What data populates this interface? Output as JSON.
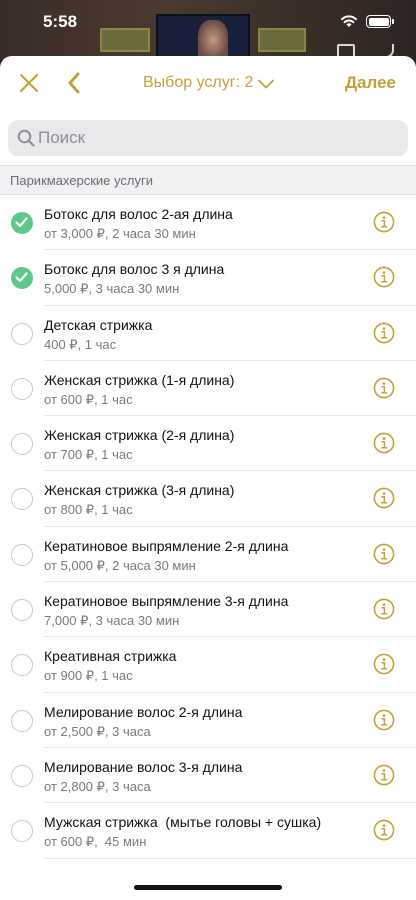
{
  "status_bar": {
    "time": "5:58"
  },
  "nav": {
    "title": "Выбор услуг: 2",
    "next_label": "Далее"
  },
  "search": {
    "placeholder": "Поиск"
  },
  "section": {
    "title": "Парикмахерские услуги"
  },
  "colors": {
    "accent": "#c4a03a",
    "check": "#5cc98b"
  },
  "services": [
    {
      "name": "Ботокс для волос 2-ая длина",
      "meta": "от 3,000 ₽, 2 часа 30 мин",
      "selected": true
    },
    {
      "name": "Ботокс для волос 3 я длина",
      "meta": "5,000 ₽, 3 часа 30 мин",
      "selected": true
    },
    {
      "name": "Детская стрижка",
      "meta": "400 ₽, 1 час",
      "selected": false
    },
    {
      "name": "Женская стрижка (1-я длина)",
      "meta": "от 600 ₽, 1 час",
      "selected": false
    },
    {
      "name": "Женская стрижка (2-я длина)",
      "meta": "от 700 ₽, 1 час",
      "selected": false
    },
    {
      "name": "Женская стрижка (3-я длина)",
      "meta": "от 800 ₽, 1 час",
      "selected": false
    },
    {
      "name": "Кератиновое выпрямление 2-я длина",
      "meta": "от 5,000 ₽, 2 часа 30 мин",
      "selected": false
    },
    {
      "name": "Кератиновое выпрямление 3-я длина",
      "meta": "7,000 ₽, 3 часа 30 мин",
      "selected": false
    },
    {
      "name": "Креативная стрижка",
      "meta": "от 900 ₽, 1 час",
      "selected": false
    },
    {
      "name": "Мелирование волос 2-я длина",
      "meta": "от 2,500 ₽, 3 часа",
      "selected": false
    },
    {
      "name": "Мелирование волос 3-я длина",
      "meta": "от 2,800 ₽, 3 часа",
      "selected": false
    },
    {
      "name": "Мужская стрижка  (мытье головы + сушка)",
      "meta": "от 600 ₽,  45 мин",
      "selected": false
    }
  ]
}
